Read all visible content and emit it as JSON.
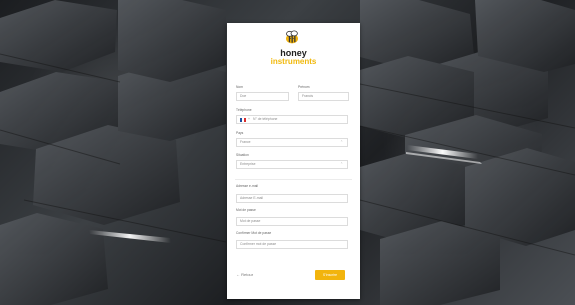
{
  "brand": {
    "line1": "honey",
    "line2": "instruments",
    "logo_icon": "bee-icon",
    "accent": "#f2b40d"
  },
  "form": {
    "last_name": {
      "label": "Nom",
      "value": "Doe"
    },
    "first_name": {
      "label": "Prénom",
      "value": "Francis"
    },
    "phone": {
      "label": "Téléphone",
      "country_flag": "france-flag-icon",
      "prefix": "+",
      "placeholder": "N° de téléphone"
    },
    "country": {
      "label": "Pays",
      "value": "France"
    },
    "situation": {
      "label": "Situation",
      "value": "Entreprise"
    },
    "email": {
      "label": "Adresse e-mail",
      "placeholder": "Adresse E-mail"
    },
    "password": {
      "label": "Mot de passe",
      "placeholder": "Mot de passe"
    },
    "confirm_password": {
      "label": "Confirmer Mot de passe",
      "placeholder": "Confirmer mot de passe"
    }
  },
  "actions": {
    "back_label": "← Retour",
    "submit_label": "S'inscrire"
  }
}
